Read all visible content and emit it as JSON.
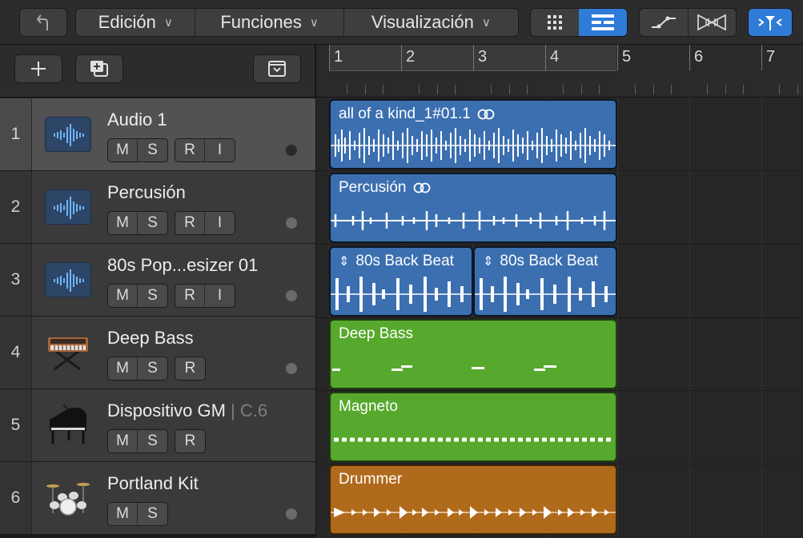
{
  "toolbar": {
    "menus": [
      {
        "label": "Edición"
      },
      {
        "label": "Funciones"
      },
      {
        "label": "Visualización"
      }
    ],
    "accent_color": "#2f7bd8"
  },
  "ruler": {
    "bars": [
      "1",
      "2",
      "3",
      "4",
      "5",
      "6",
      "7"
    ]
  },
  "tracks": [
    {
      "number": "1",
      "name": "Audio 1",
      "extra": "",
      "buttons": [
        "M",
        "S",
        "R",
        "I"
      ],
      "icon": "audio-waveform-icon"
    },
    {
      "number": "2",
      "name": "Percusión",
      "extra": "",
      "buttons": [
        "M",
        "S",
        "R",
        "I"
      ],
      "icon": "audio-waveform-icon"
    },
    {
      "number": "3",
      "name": "80s Pop...esizer 01",
      "extra": "",
      "buttons": [
        "M",
        "S",
        "R",
        "I"
      ],
      "icon": "audio-waveform-icon"
    },
    {
      "number": "4",
      "name": "Deep Bass",
      "extra": "",
      "buttons": [
        "M",
        "S",
        "R"
      ],
      "icon": "synthesizer-icon"
    },
    {
      "number": "5",
      "name": "Dispositivo GM",
      "extra": "| C.6",
      "buttons": [
        "M",
        "S",
        "R"
      ],
      "icon": "piano-icon"
    },
    {
      "number": "6",
      "name": "Portland Kit",
      "extra": "",
      "buttons": [
        "M",
        "S"
      ],
      "icon": "drum-kit-icon"
    }
  ],
  "regions": [
    {
      "track": "1",
      "label": "all of a kind_1#01.1",
      "type": "audio",
      "loop_icon": true
    },
    {
      "track": "2",
      "label": "Percusión",
      "type": "audio",
      "loop_icon": true
    },
    {
      "track": "3",
      "label": "80s Back Beat",
      "type": "audio",
      "loop_icon": false
    },
    {
      "track": "3",
      "label": "80s Back Beat",
      "type": "audio",
      "loop_icon": false
    },
    {
      "track": "4",
      "label": "Deep Bass",
      "type": "midi",
      "loop_icon": false
    },
    {
      "track": "5",
      "label": "Magneto",
      "type": "midi",
      "loop_icon": false
    },
    {
      "track": "6",
      "label": "Drummer",
      "type": "drummer",
      "loop_icon": false
    }
  ],
  "colors": {
    "audio_region": "#3b6fb0",
    "midi_region": "#56a92c",
    "drummer_region": "#b06a1c"
  }
}
